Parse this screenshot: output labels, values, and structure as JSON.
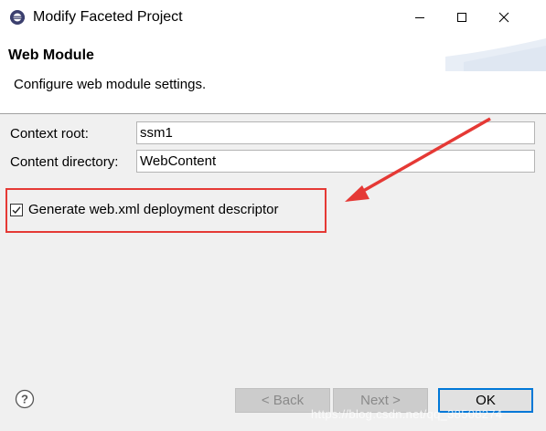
{
  "window": {
    "title": "Modify Faceted Project"
  },
  "banner": {
    "title": "Web Module",
    "description": "Configure web module settings."
  },
  "form": {
    "context_root_label": "Context root:",
    "context_root_value": "ssm1",
    "content_dir_label": "Content directory:",
    "content_dir_value": "WebContent",
    "generate_xml_label": "Generate web.xml deployment descriptor",
    "generate_xml_checked": true
  },
  "buttons": {
    "back": "< Back",
    "next": "Next >",
    "ok": "OK"
  },
  "annotation": {
    "color": "#e53935"
  },
  "watermark": "https://blog.csdn.net/qq_38508274",
  "icons": {
    "app": "eclipse-icon",
    "minimize": "minimize-icon",
    "maximize": "maximize-icon",
    "close": "close-icon",
    "help": "help-icon",
    "check": "checkmark-icon"
  },
  "colors": {
    "ok_border": "#0078d7",
    "disabled_button": "#cccccc",
    "dialog_bg": "#f0f0f0"
  }
}
